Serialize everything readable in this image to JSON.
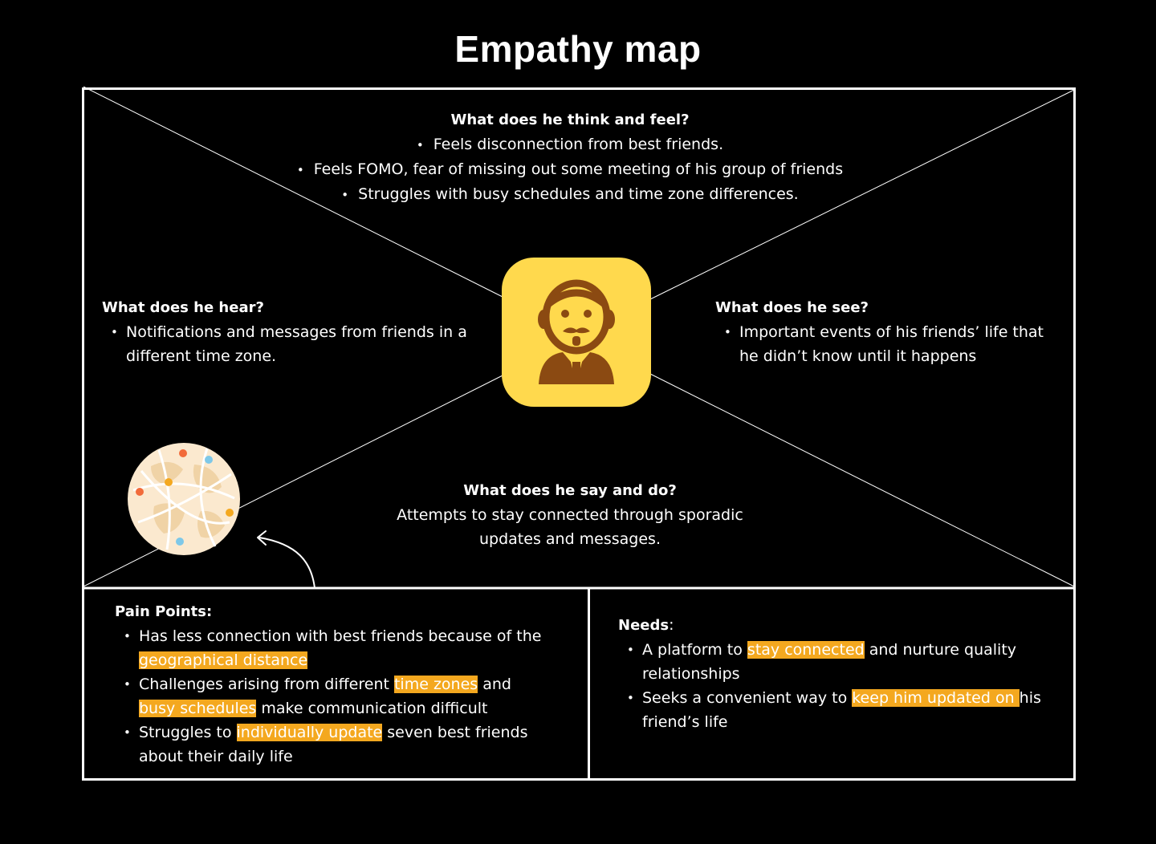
{
  "title": "Empathy map",
  "think_feel": {
    "heading": "What does he think and feel?",
    "items": [
      "Feels disconnection from best friends.",
      "Feels FOMO, fear of missing out some meeting of his group of friends",
      "Struggles with busy schedules and time zone differences."
    ]
  },
  "hear": {
    "heading": "What does he hear?",
    "items": [
      "Notifications and messages from friends in a different time zone."
    ]
  },
  "see": {
    "heading": "What does he see?",
    "items": [
      "Important events of his friends’ life that he didn’t know until it happens"
    ]
  },
  "say_do": {
    "heading": "What does he say and do?",
    "text": "Attempts to stay connected through sporadic updates and messages."
  },
  "pain_points": {
    "heading": "Pain Points:",
    "item1": {
      "before": "Has less connection with best friends because of the ",
      "hl": "geographical distance"
    },
    "item2": {
      "before": "Challenges arising from different ",
      "hl1": "time zones",
      "mid": " and ",
      "hl2": "busy schedules",
      "after": " make communication difficult"
    },
    "item3": {
      "before": "Struggles to ",
      "hl": "individually update",
      "after": " seven best friends about their daily life"
    }
  },
  "needs": {
    "heading": "Needs",
    "colon": ":",
    "item1": {
      "before": "A platform to ",
      "hl": "stay connected",
      "after": " and nurture quality relationships"
    },
    "item2": {
      "before": "Seeks a convenient way to ",
      "hl": "keep him updated on ",
      "after": "his friend’s life"
    }
  },
  "icons": {
    "center": "man-avatar-icon",
    "globe": "globe-network-icon",
    "arrow": "curved-arrow-icon"
  },
  "colors": {
    "background": "#000000",
    "highlight": "#f4a81f",
    "avatar_tile": "#ffd94d",
    "avatar_figure": "#8b4a12"
  }
}
